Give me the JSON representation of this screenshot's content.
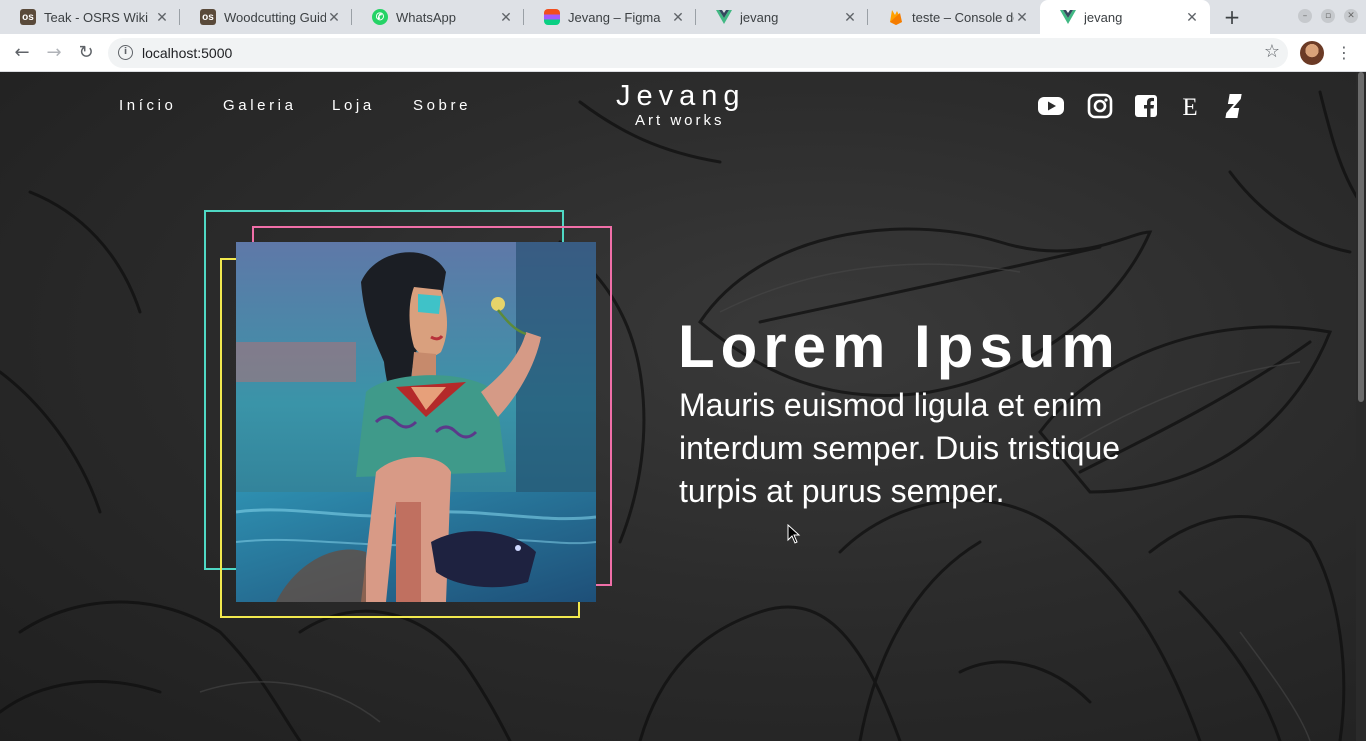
{
  "browser": {
    "tabs": [
      {
        "title": "Teak - OSRS Wiki",
        "icon": "osrs-wiki-icon"
      },
      {
        "title": "Woodcutting Guide",
        "icon": "osrs-wiki-icon"
      },
      {
        "title": "WhatsApp",
        "icon": "whatsapp-icon"
      },
      {
        "title": "Jevang – Figma",
        "icon": "figma-icon"
      },
      {
        "title": "jevang",
        "icon": "vue-icon"
      },
      {
        "title": "teste – Console do",
        "icon": "firebase-icon"
      },
      {
        "title": "jevang",
        "icon": "vue-icon"
      }
    ],
    "active_tab": 6,
    "url": "localhost:5000"
  },
  "site": {
    "nav": [
      "Início",
      "Galeria",
      "Loja",
      "Sobre"
    ],
    "logo": {
      "title": "Jevang",
      "subtitle": "Art works"
    },
    "social": [
      "youtube-icon",
      "instagram-icon",
      "facebook-icon",
      "etsy-icon",
      "deviantart-icon"
    ],
    "hero": {
      "title": "Lorem Ipsum",
      "text": "Mauris euismod ligula et enim interdum semper. Duis tristique turpis at purus semper."
    },
    "frame_colors": {
      "teal": "#4fd8c4",
      "pink": "#f06fa8",
      "yellow": "#f2e94e"
    }
  }
}
